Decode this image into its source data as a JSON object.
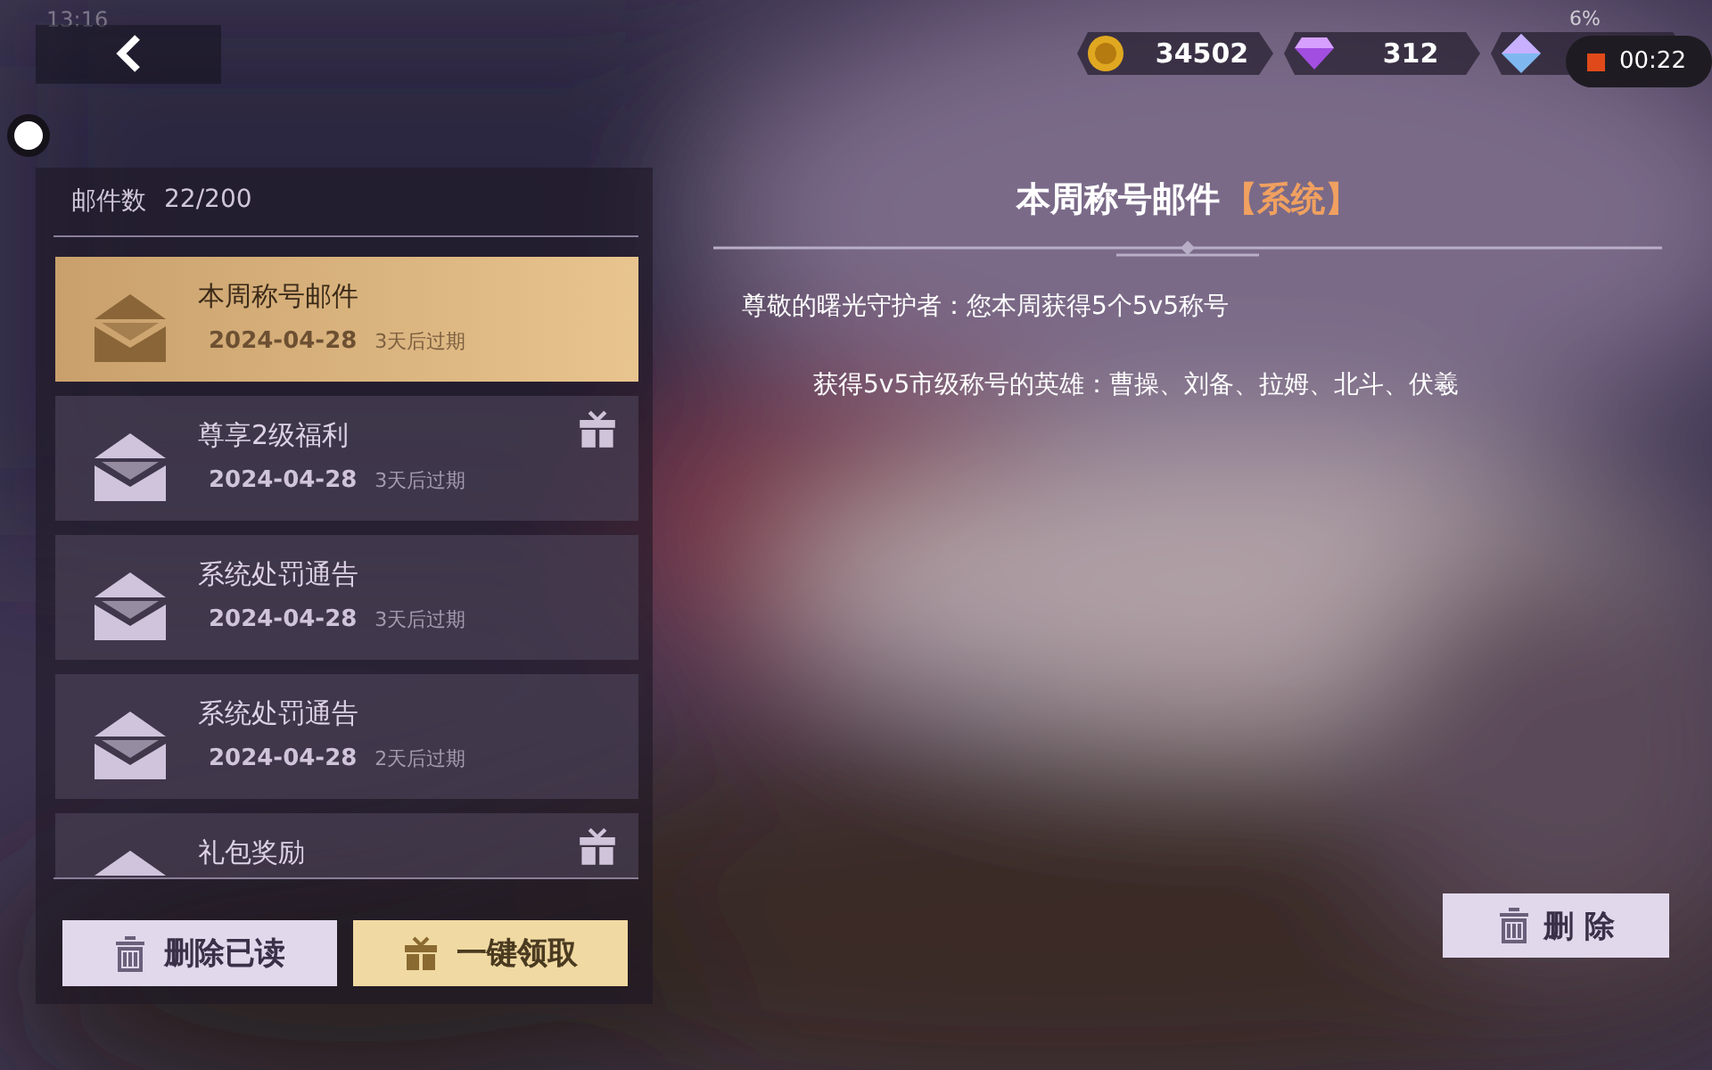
{
  "status_bar": {
    "time": "13:16",
    "battery": "6%"
  },
  "recording": {
    "timer": "00:22"
  },
  "currencies": [
    {
      "kind": "coin",
      "amount": "34502"
    },
    {
      "kind": "gem",
      "amount": "312"
    },
    {
      "kind": "crystal"
    }
  ],
  "mail_list": {
    "count_label": "邮件数",
    "count": "22/200",
    "items": [
      {
        "title": "本周称号邮件",
        "date": "2024-04-28",
        "expiry": "3天后过期",
        "selected": true,
        "has_gift": false
      },
      {
        "title": "尊享2级福利",
        "date": "2024-04-28",
        "expiry": "3天后过期",
        "selected": false,
        "has_gift": true
      },
      {
        "title": "系统处罚通告",
        "date": "2024-04-28",
        "expiry": "3天后过期",
        "selected": false,
        "has_gift": false
      },
      {
        "title": "系统处罚通告",
        "date": "2024-04-28",
        "expiry": "2天后过期",
        "selected": false,
        "has_gift": false
      },
      {
        "title": "礼包奖励",
        "selected": false,
        "has_gift": true
      }
    ],
    "buttons": [
      {
        "kind": "delete",
        "label": "删除已读"
      },
      {
        "kind": "claim",
        "label": "一键领取"
      }
    ]
  },
  "mail_detail": {
    "title": "本周称号邮件",
    "tag": "【系统】",
    "lines": [
      "尊敬的曙光守护者：您本周获得5个5v5称号",
      "获得5v5市级称号的英雄：曹操、刘备、拉姆、北斗、伏羲"
    ],
    "delete_button": "删 除"
  }
}
